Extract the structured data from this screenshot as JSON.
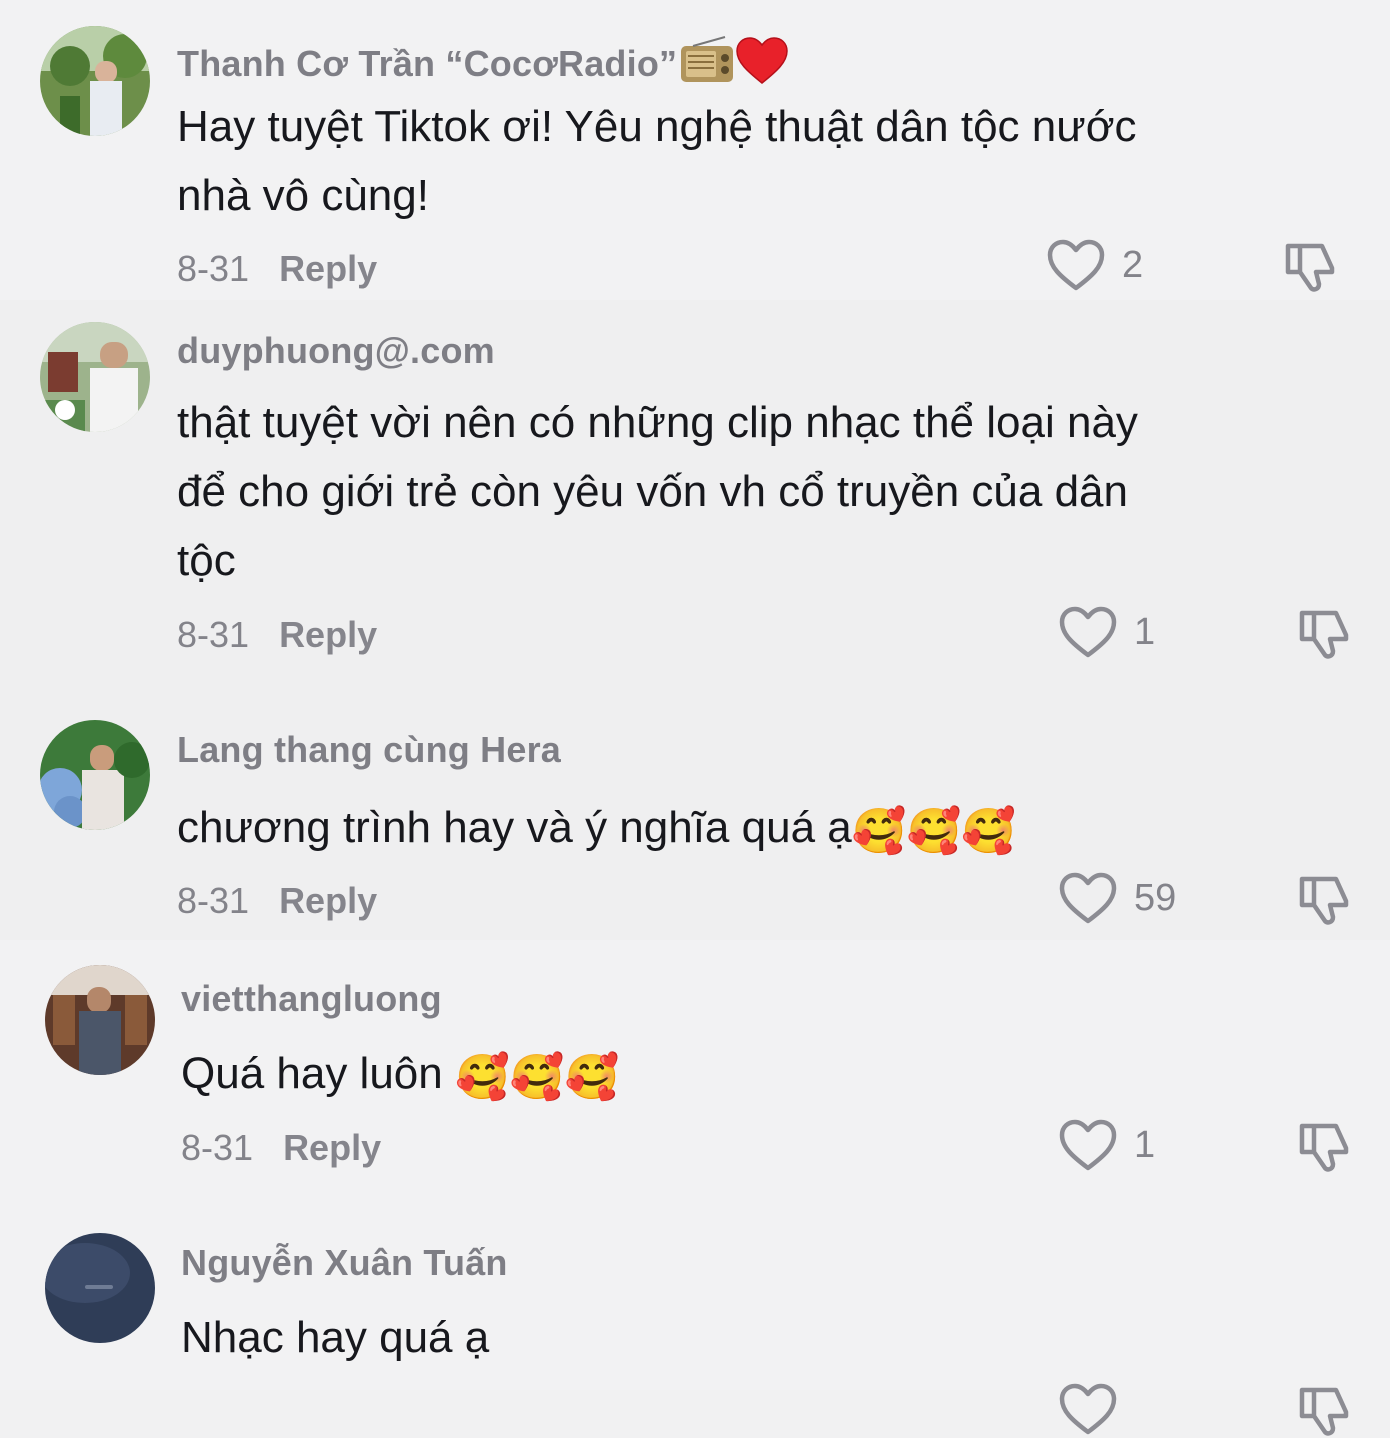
{
  "comments": [
    {
      "username": "Thanh Cơ Trần “CocơRadio”",
      "username_icons": [
        "radio-icon",
        "red-heart-icon"
      ],
      "text": "Hay tuyệt Tiktok ơi! Yêu nghệ thuật dân tộc nước nhà vô cùng!",
      "date": "8-31",
      "reply": "Reply",
      "likes": "2"
    },
    {
      "username": "duyphuong@.com",
      "text": "thật tuyệt vời nên có những clip nhạc thể loại này để cho giới trẻ còn yêu vốn vh cổ truyền của dân tộc",
      "date": "8-31",
      "reply": "Reply",
      "likes": "1"
    },
    {
      "username": "Lang thang cùng Hera",
      "text": "chương trình hay và ý nghĩa quá ạ",
      "emojis": "🥰🥰🥰",
      "date": "8-31",
      "reply": "Reply",
      "likes": "59"
    },
    {
      "username": "vietthangluong",
      "text": "Quá hay luôn ",
      "emojis": "🥰🥰🥰",
      "date": "8-31",
      "reply": "Reply",
      "likes": "1"
    },
    {
      "username": "Nguyễn Xuân Tuấn",
      "text": "Nhạc hay quá ạ"
    }
  ],
  "colors": {
    "background": "#f1f1f2",
    "text": "#17181d",
    "muted": "#83838a"
  },
  "icons": [
    "heart-outline-icon",
    "thumbs-down-icon"
  ]
}
